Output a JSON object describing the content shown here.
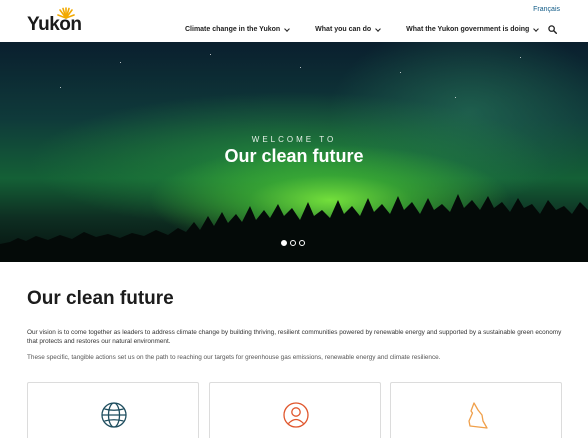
{
  "header": {
    "logo_text": "Yukon",
    "language_link": "Français",
    "nav": [
      {
        "label": "Climate change in the Yukon"
      },
      {
        "label": "What you can do"
      },
      {
        "label": "What the Yukon government is doing"
      }
    ]
  },
  "hero": {
    "eyebrow": "WELCOME TO",
    "title": "Our clean future",
    "slides": 3,
    "active_slide": 1
  },
  "main": {
    "title": "Our clean future",
    "paragraph_1": "Our vision is to come together as leaders to address climate change by building thriving, resilient communities powered by renewable energy and supported by a sustainable green economy that protects and restores our natural environment.",
    "paragraph_2": "These specific, tangible actions set us on the path to reaching our targets for greenhouse gas emissions, renewable energy and climate resilience.",
    "cards": [
      {
        "icon": "globe-icon",
        "color": "#1f4e5f"
      },
      {
        "icon": "person-icon",
        "color": "#e0562c"
      },
      {
        "icon": "mountain-icon",
        "color": "#f0a04b"
      }
    ]
  },
  "colors": {
    "link": "#0f5a86",
    "logo_sun": "#f2a900"
  }
}
